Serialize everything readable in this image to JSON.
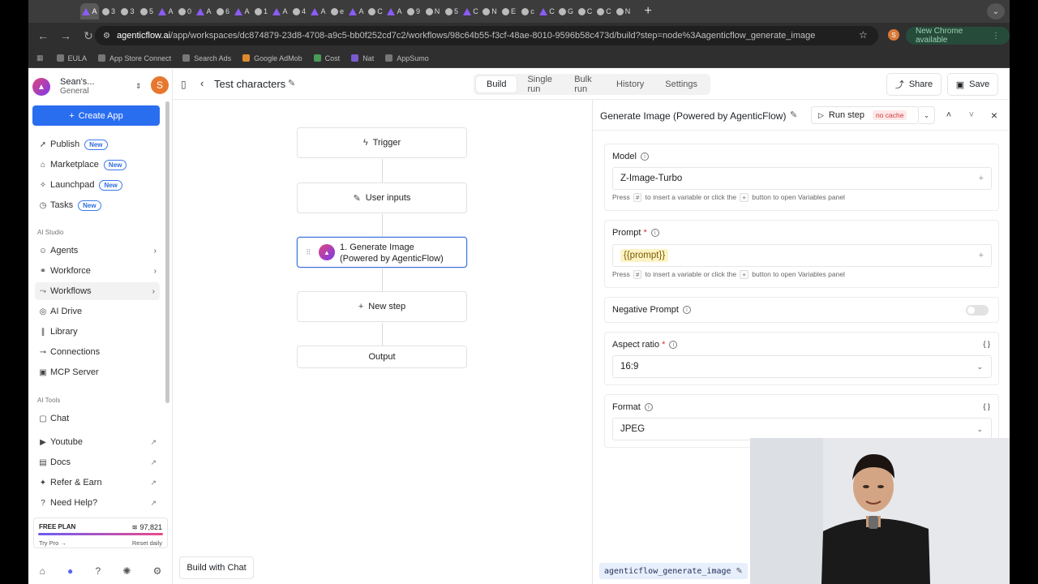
{
  "browser": {
    "tabs": [
      "A",
      "3",
      "3",
      "5",
      "A",
      "0",
      "A",
      "6",
      "A",
      "1",
      "A",
      "4",
      "A",
      "e",
      "A",
      "C",
      "A",
      "9",
      "N",
      "5",
      "C",
      "N",
      "E",
      "c",
      "C",
      "G",
      "C",
      "C",
      "N"
    ],
    "url_host": "agenticflow.ai",
    "url_path": "/app/workspaces/dc874879-23d8-4708-a9c5-bb0f252cd7c2/workflows/98c64b55-f3cf-48ae-8010-9596b58c473d/build?step=node%3Aagenticflow_generate_image",
    "profile_initial": "S",
    "new_chrome_label": "New Chrome available",
    "bookmarks": [
      "EULA",
      "App Store Connect",
      "Search Ads",
      "Google AdMob",
      "Cost",
      "Nat",
      "AppSumo"
    ]
  },
  "sidebar": {
    "workspace_name": "Sean's...",
    "workspace_sub": "General",
    "avatar_initial": "S",
    "create_label": "Create App",
    "top_items": [
      {
        "label": "Publish",
        "badge": "New"
      },
      {
        "label": "Marketplace",
        "badge": "New"
      },
      {
        "label": "Launchpad",
        "badge": "New"
      },
      {
        "label": "Tasks",
        "badge": "New"
      }
    ],
    "section_ai_studio": "AI Studio",
    "studio_items": [
      {
        "label": "Agents"
      },
      {
        "label": "Workforce"
      },
      {
        "label": "Workflows"
      },
      {
        "label": "AI Drive"
      },
      {
        "label": "Library"
      },
      {
        "label": "Connections"
      },
      {
        "label": "MCP Server"
      }
    ],
    "section_ai_tools": "AI Tools",
    "tools_items": [
      {
        "label": "Chat"
      }
    ],
    "link_items": [
      {
        "label": "Youtube"
      },
      {
        "label": "Docs"
      },
      {
        "label": "Refer & Earn"
      },
      {
        "label": "Need Help?"
      }
    ],
    "plan": {
      "label": "FREE PLAN",
      "credits": "97,821",
      "try_pro": "Try Pro →",
      "reset": "Reset daily"
    }
  },
  "header": {
    "title": "Test characters",
    "tabs": [
      "Build",
      "Single run",
      "Bulk run",
      "History",
      "Settings"
    ],
    "active_tab": "Build",
    "share_label": "Share",
    "save_label": "Save"
  },
  "canvas": {
    "nodes": {
      "trigger": "Trigger",
      "user_inputs": "User inputs",
      "gen_line1": "1. Generate Image",
      "gen_line2": "(Powered by AgenticFlow)",
      "new_step": "New step",
      "output": "Output"
    },
    "build_with_chat": "Build with Chat"
  },
  "panel": {
    "title": "Generate Image (Powered by AgenticFlow)",
    "run_label": "Run step",
    "no_cache": "no cache",
    "model_label": "Model",
    "model_value": "Z-Image-Turbo",
    "hint_pre": "Press",
    "hint_key": "#",
    "hint_mid": "to insert a variable or click the",
    "hint_key2": "+",
    "hint_post": "button to open Variables panel",
    "prompt_label": "Prompt",
    "prompt_value": "{{prompt}}",
    "negative_label": "Negative Prompt",
    "negative_enabled": false,
    "aspect_label": "Aspect ratio",
    "aspect_value": "16:9",
    "format_label": "Format",
    "format_value": "JPEG",
    "json_glyph": "{ }",
    "node_id": "agenticflow_generate_image"
  },
  "colors": {
    "accent": "#2a6ef0",
    "selected_border": "#3b6fe0",
    "var_pill_bg": "#fdf3c4",
    "no_cache_bg": "#fde8e8"
  }
}
